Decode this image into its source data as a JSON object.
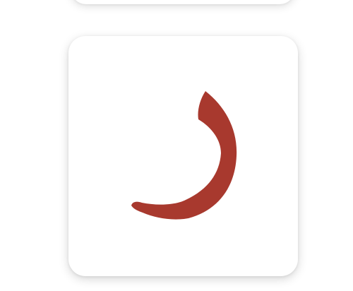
{
  "letter_card": {
    "glyph_icon": "arabic-letter-ra",
    "glyph_color": "#A8392E",
    "card_background": "#FFFFFF"
  }
}
